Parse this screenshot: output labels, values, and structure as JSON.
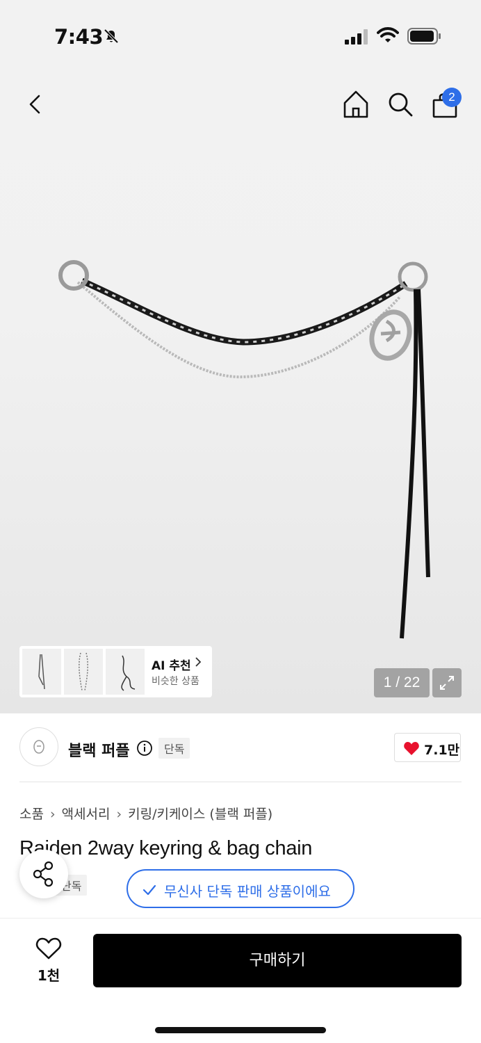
{
  "status_bar": {
    "time": "7:43"
  },
  "nav": {
    "cart_count": "2"
  },
  "gallery": {
    "counter": "1 / 22",
    "ai_recommend": {
      "title": "AI 추천",
      "subtitle": "비슷한 상품"
    }
  },
  "brand": {
    "name": "블랙 퍼플",
    "badge": "단독",
    "likes": "7.1만"
  },
  "breadcrumb": [
    "소품",
    "액세서리",
    "키링/키케이스 (블랙 퍼플)"
  ],
  "product": {
    "title": "Raiden 2way keyring & bag chain",
    "badge": "단독",
    "exclusive_notice": "무신사 단독 판매 상품이에요"
  },
  "bottom_bar": {
    "wish_count": "1천",
    "buy_label": "구매하기"
  },
  "colors": {
    "accent": "#2e6ee8",
    "heart": "#e8112d",
    "buy_button": "#000000"
  },
  "icons": [
    "bell-slash-icon",
    "signal-icon",
    "wifi-icon",
    "battery-icon",
    "back-icon",
    "home-icon",
    "search-icon",
    "shopping-bag-icon",
    "chevron-right-icon",
    "expand-icon",
    "info-icon",
    "heart-icon",
    "share-icon",
    "check-icon"
  ]
}
